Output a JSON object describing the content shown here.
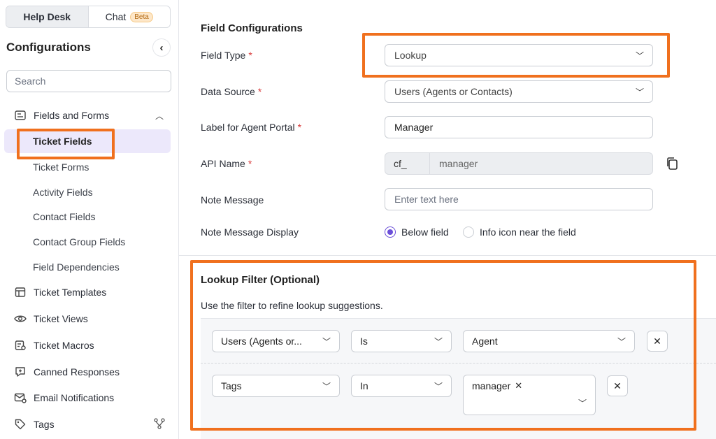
{
  "sidebar": {
    "tabs": [
      {
        "label": "Help Desk",
        "active": true
      },
      {
        "label": "Chat",
        "badge": "Beta",
        "active": false
      }
    ],
    "title": "Configurations",
    "search_placeholder": "Search",
    "groups": [
      {
        "label": "Fields and Forms",
        "icon": "form-fields-icon",
        "expanded": true
      }
    ],
    "sub_items": [
      {
        "label": "Ticket Fields",
        "active": true
      },
      {
        "label": "Ticket Forms"
      },
      {
        "label": "Activity Fields"
      },
      {
        "label": "Contact Fields"
      },
      {
        "label": "Contact Group Fields"
      },
      {
        "label": "Field Dependencies"
      }
    ],
    "items": [
      {
        "label": "Ticket Templates",
        "icon": "template-icon"
      },
      {
        "label": "Ticket Views",
        "icon": "eye-icon"
      },
      {
        "label": "Ticket Macros",
        "icon": "macro-icon"
      },
      {
        "label": "Canned Responses",
        "icon": "canned-response-icon"
      },
      {
        "label": "Email Notifications",
        "icon": "email-icon"
      },
      {
        "label": "Tags",
        "icon": "tag-icon"
      }
    ]
  },
  "main": {
    "section_title": "Field Configurations",
    "field_type": {
      "label": "Field Type",
      "required": "*",
      "value": "Lookup"
    },
    "data_source": {
      "label": "Data Source",
      "required": "*",
      "value": "Users (Agents or Contacts)"
    },
    "agent_label": {
      "label": "Label for Agent Portal",
      "required": "*",
      "value": "Manager"
    },
    "api_name": {
      "label": "API Name",
      "required": "*",
      "prefix": "cf_",
      "value": "manager"
    },
    "note_message": {
      "label": "Note Message",
      "placeholder": "Enter text here"
    },
    "note_display": {
      "label": "Note Message Display",
      "options": [
        {
          "label": "Below field",
          "selected": true
        },
        {
          "label": "Info icon near the field",
          "selected": false
        }
      ]
    },
    "lookup": {
      "title": "Lookup Filter (Optional)",
      "description": "Use the filter to refine lookup suggestions.",
      "rows": [
        {
          "field": "Users (Agents or...",
          "operator": "Is",
          "value": "Agent"
        },
        {
          "field": "Tags",
          "operator": "In",
          "chips": [
            "manager"
          ]
        }
      ]
    }
  },
  "colors": {
    "highlight": "#f0701e",
    "accent": "#6b4fd8",
    "active_bg": "#ece8fb",
    "required": "#d83a3a"
  }
}
